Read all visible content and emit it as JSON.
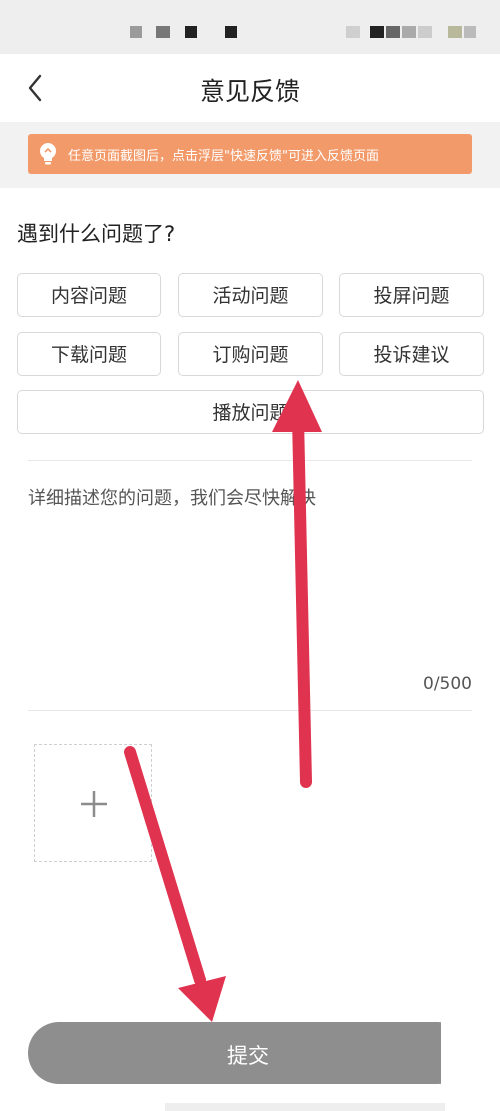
{
  "header": {
    "title": "意见反馈",
    "back_icon": "chevron-left-icon"
  },
  "tip": {
    "text": "任意页面截图后，点击浮层\"快速反馈\"可进入反馈页面",
    "icon": "lightbulb-icon",
    "color": "#f39a6a"
  },
  "question": {
    "title": "遇到什么问题了?"
  },
  "categories": [
    "内容问题",
    "活动问题",
    "投屏问题",
    "下载问题",
    "订购问题",
    "投诉建议",
    "播放问题"
  ],
  "description": {
    "placeholder": "详细描述您的问题，我们会尽快解决",
    "count": "0/500"
  },
  "upload": {
    "icon": "plus-icon"
  },
  "submit": {
    "label": "提交",
    "color": "#8e8e8e"
  },
  "annotation": {
    "arrow_color": "#e0334f"
  }
}
